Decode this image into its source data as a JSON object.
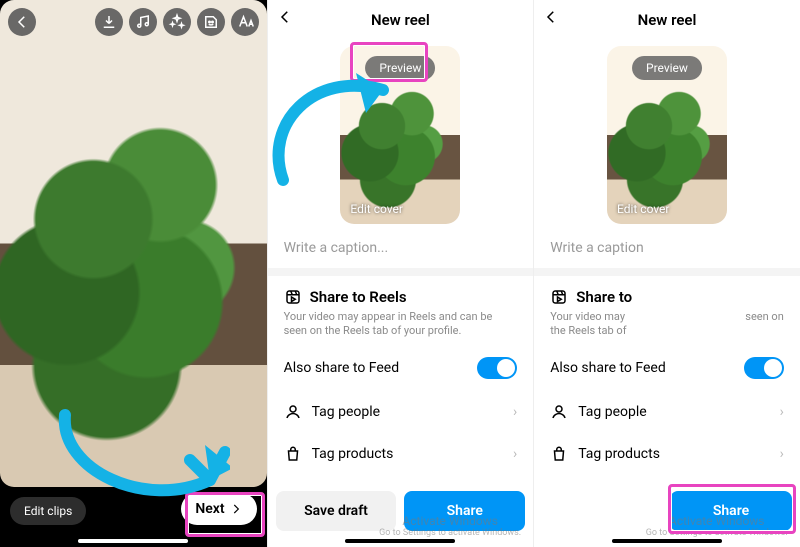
{
  "screen1": {
    "toolbar_icons": [
      "back-icon",
      "download-icon",
      "music-icon",
      "effects-icon",
      "sticker-icon",
      "text-icon"
    ],
    "edit_clips": "Edit clips",
    "next": "Next"
  },
  "screen2": {
    "title": "New reel",
    "preview": "Preview",
    "edit_cover": "Edit cover",
    "caption_placeholder": "Write a caption...",
    "share_heading": "Share to Reels",
    "share_desc": "Your video may appear in Reels and can be seen on the Reels tab of your profile.",
    "also_share": "Also share to Feed",
    "tag_people": "Tag people",
    "tag_products": "Tag products",
    "save_draft": "Save draft",
    "share_btn": "Share"
  },
  "screen3": {
    "title": "New reel",
    "preview": "Preview",
    "edit_cover": "Edit cover",
    "caption_placeholder": "Write a caption",
    "share_heading": "Share to",
    "share_desc_left": "Your video may",
    "share_desc_right": "seen on",
    "share_desc_line2": "the Reels tab of",
    "also_share": "Also share to Feed",
    "tag_people": "Tag people",
    "tag_products": "Tag products",
    "share_btn": "Share"
  },
  "watermark": {
    "line1": "Activate Windows",
    "line2": "Go to Settings to activate Windows."
  },
  "colors": {
    "highlight": "#e844c0",
    "arrow": "#14b2e6",
    "accent": "#0095f6"
  }
}
